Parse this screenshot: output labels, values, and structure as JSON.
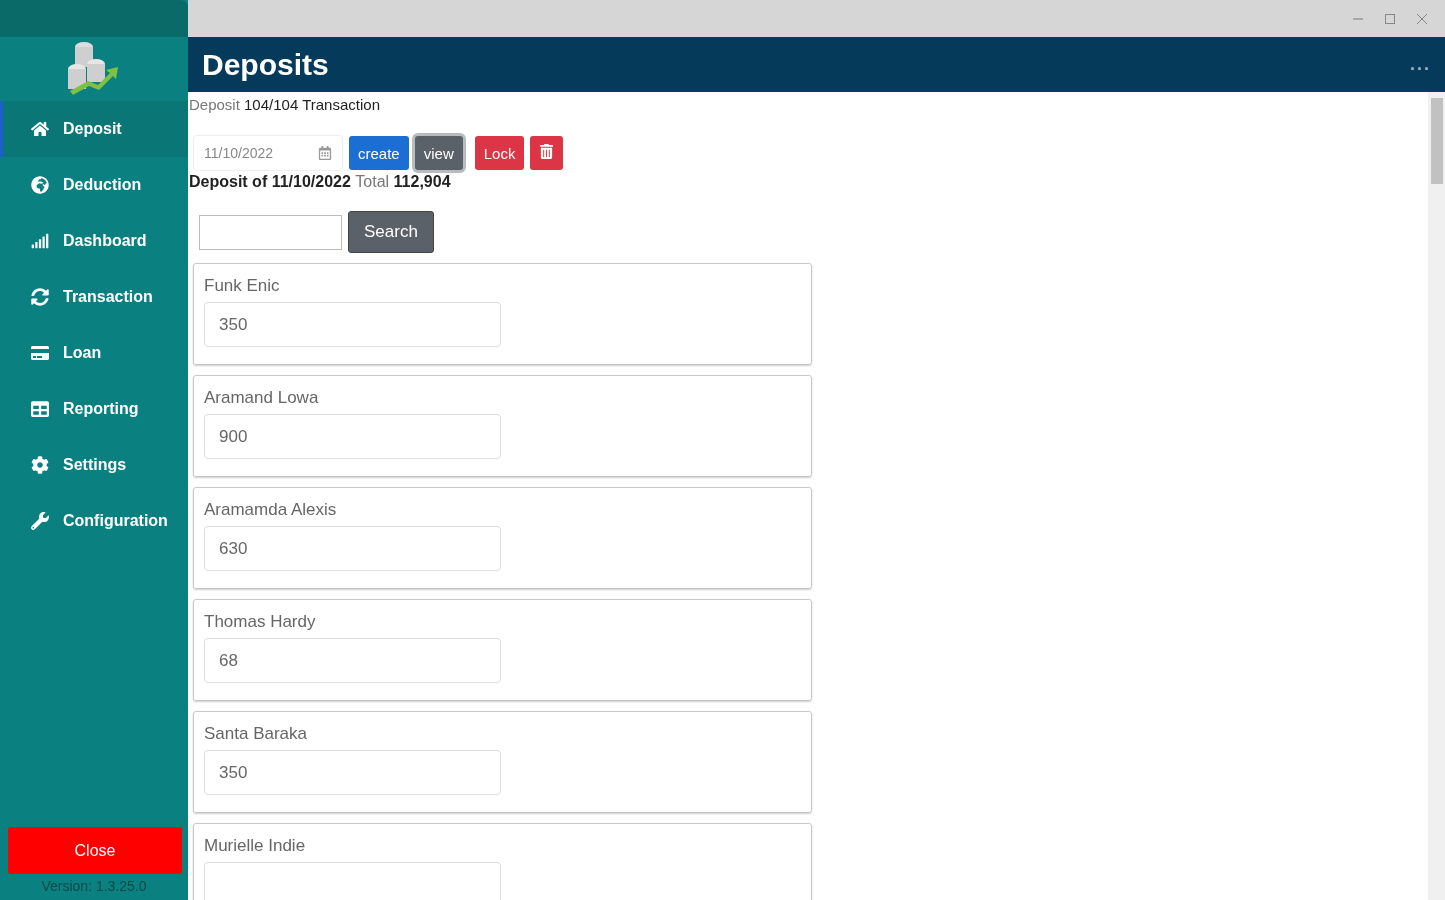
{
  "sidebar": {
    "items": [
      {
        "label": "Deposit",
        "selected": true
      },
      {
        "label": "Deduction",
        "selected": false
      },
      {
        "label": "Dashboard",
        "selected": false
      },
      {
        "label": "Transaction",
        "selected": false
      },
      {
        "label": "Loan",
        "selected": false
      },
      {
        "label": "Reporting",
        "selected": false
      },
      {
        "label": "Settings",
        "selected": false
      },
      {
        "label": "Configuration",
        "selected": false
      }
    ],
    "close_button": "Close",
    "version": "Version: 1.3.25.0"
  },
  "header": {
    "title": "Deposits",
    "menu": "..."
  },
  "summary": {
    "prefix": "Deposit",
    "count": "104/104",
    "suffix": "Transaction"
  },
  "toolbar": {
    "date": "11/10/2022",
    "buttons": [
      {
        "label": "create",
        "kind": "primary"
      },
      {
        "label": "view",
        "kind": "secondary"
      },
      {
        "label": "Lock",
        "kind": "danger"
      },
      {
        "kind": "delete"
      }
    ]
  },
  "total": {
    "prefix": "Deposit of",
    "date": "11/10/2022",
    "label": "Total",
    "amount": "112,904"
  },
  "search": {
    "button": "Search"
  },
  "entries": [
    {
      "name": "Funk Enic",
      "value": "350"
    },
    {
      "name": "Aramand Lowa",
      "value": "900"
    },
    {
      "name": "Aramamda Alexis",
      "value": "630"
    },
    {
      "name": "Thomas Hardy",
      "value": "68"
    },
    {
      "name": "Santa Baraka",
      "value": "350"
    },
    {
      "name": "Murielle Indie"
    }
  ]
}
